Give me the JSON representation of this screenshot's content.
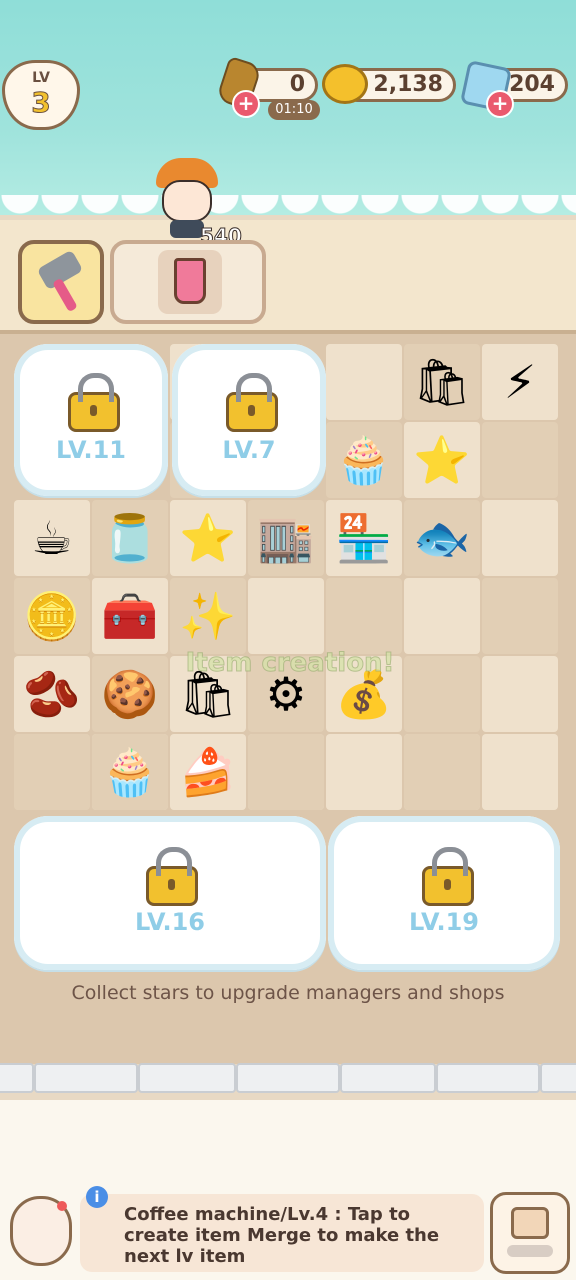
{
  "hud": {
    "level_label": "LV",
    "level": "3",
    "energy_count": "0",
    "energy_timer": "01:10",
    "coins": "2,138",
    "gems": "204",
    "plus_symbol": "+"
  },
  "character": {
    "floating_coins": "540"
  },
  "toolbar": {
    "tool_icon": "hammer-icon",
    "active_item_icon": "coffee-cup-icon"
  },
  "board": {
    "locked_areas": [
      {
        "label": "LV.11"
      },
      {
        "label": "LV.7"
      },
      {
        "label": "LV.16"
      },
      {
        "label": "LV.19"
      }
    ],
    "toast": "Item creation!",
    "hint": "Collect stars to upgrade managers and shops",
    "items": [
      {
        "glyph": "🛍",
        "name": "coffee-bean-bag-item"
      },
      {
        "glyph": "⚡",
        "name": "energy-bolt-item"
      },
      {
        "glyph": "🧁",
        "name": "cupcake-item"
      },
      {
        "glyph": "⭐",
        "name": "star-item"
      },
      {
        "glyph": "☕",
        "name": "coffee-pot-item"
      },
      {
        "glyph": "🫙",
        "name": "coffee-jar-item"
      },
      {
        "glyph": "⭐",
        "name": "two-stars-item"
      },
      {
        "glyph": "🏬",
        "name": "shop-building-item"
      },
      {
        "glyph": "🏪",
        "name": "small-shop-item"
      },
      {
        "glyph": "🐟",
        "name": "fish-bread-item"
      },
      {
        "glyph": "🪙",
        "name": "coin-stack-item"
      },
      {
        "glyph": "🧰",
        "name": "locked-chest-item"
      },
      {
        "glyph": "✨",
        "name": "three-stars-item"
      },
      {
        "glyph": "🫘",
        "name": "coffee-beans-item"
      },
      {
        "glyph": "🍪",
        "name": "cat-cookies-item"
      },
      {
        "glyph": "🛍",
        "name": "coffee-bag-item"
      },
      {
        "glyph": "⚙",
        "name": "coffee-machine-item"
      },
      {
        "glyph": "💰",
        "name": "bean-sack-item"
      },
      {
        "glyph": "🧁",
        "name": "muffin-item"
      },
      {
        "glyph": "🍰",
        "name": "cream-dessert-item"
      }
    ]
  },
  "bottom_bar": {
    "info_text": "Coffee machine/Lv.4 : Tap to create item Merge to make the next lv item",
    "info_icon": "i"
  }
}
